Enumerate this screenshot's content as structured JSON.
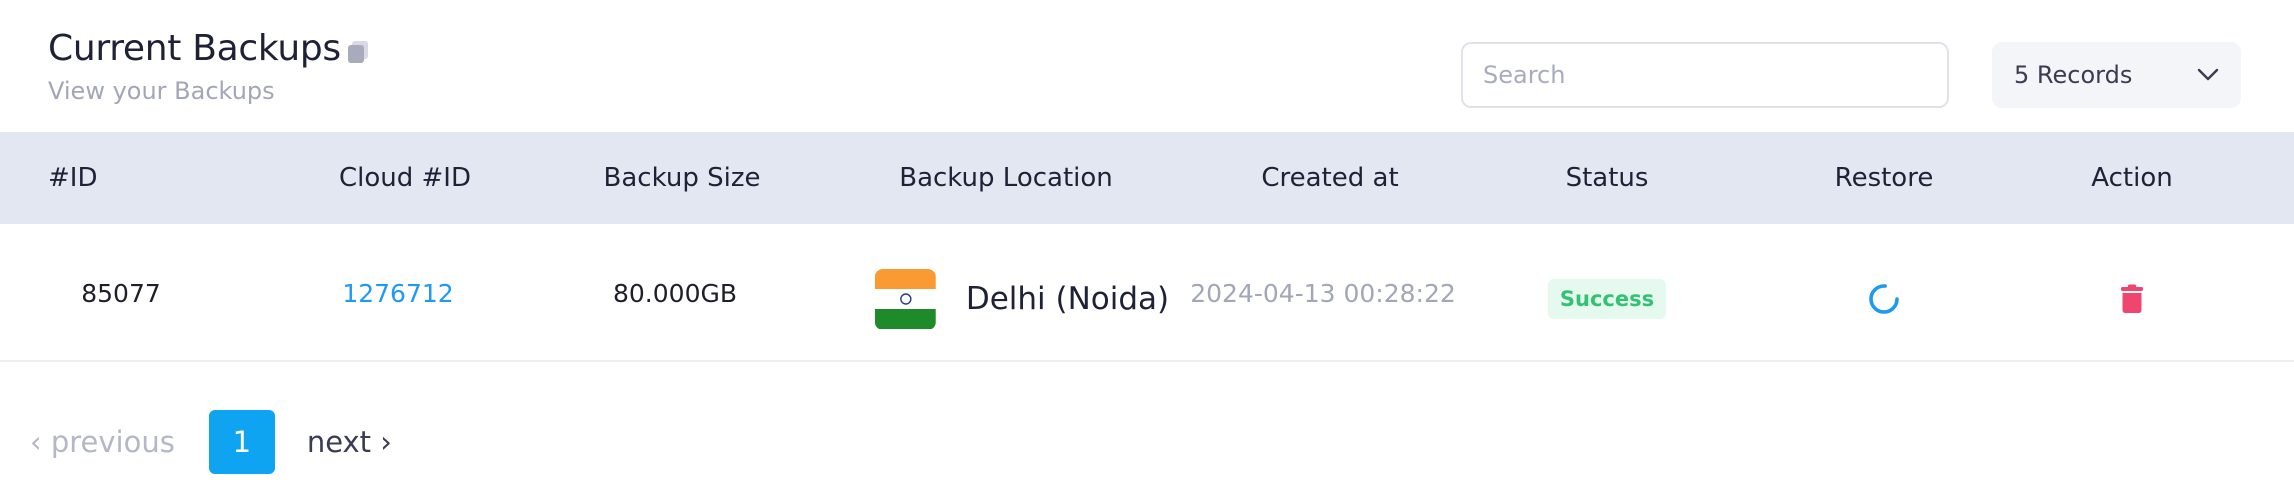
{
  "header": {
    "title": "Current Backups",
    "subtitle": "View your Backups"
  },
  "search": {
    "placeholder": "Search",
    "value": ""
  },
  "records_select": {
    "selected": "5 Records"
  },
  "table": {
    "columns": [
      "#ID",
      "Cloud #ID",
      "Backup Size",
      "Backup Location",
      "Created at",
      "Status",
      "Restore",
      "Action"
    ],
    "rows": [
      {
        "id": "85077",
        "cloud_id": "1276712",
        "size": "80.000GB",
        "location": "Delhi (Noida)",
        "flag": "india-flag",
        "created_at": "2024-04-13 00:28:22",
        "status": "Success",
        "restore_icon": "restore-spinner-icon",
        "action_icon": "trash-icon"
      }
    ]
  },
  "pagination": {
    "previous_label": "‹ previous",
    "current_page": "1",
    "next_label": "next ›"
  },
  "colors": {
    "accent": "#0ea4f2",
    "link": "#1e9af0",
    "success": "#33c173",
    "danger": "#f0456e",
    "header_bg": "#e3e7f1"
  }
}
